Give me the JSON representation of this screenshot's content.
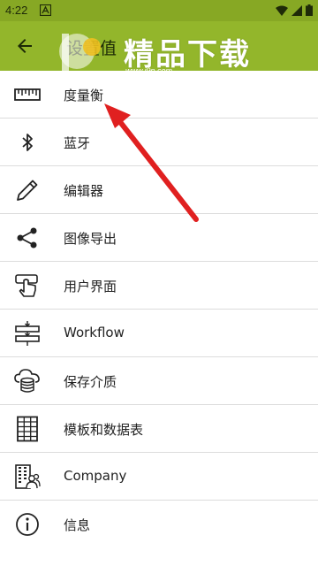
{
  "status_bar": {
    "time": "4:22"
  },
  "app_bar": {
    "title": "设置值"
  },
  "watermark": {
    "brand": "精品下载",
    "url": "www.j9p.com"
  },
  "menu": {
    "items": [
      {
        "label": "度量衡",
        "icon": "ruler-icon"
      },
      {
        "label": "蓝牙",
        "icon": "bluetooth-icon"
      },
      {
        "label": "编辑器",
        "icon": "pencil-icon"
      },
      {
        "label": "图像导出",
        "icon": "share-icon"
      },
      {
        "label": "用户界面",
        "icon": "touch-screen-icon"
      },
      {
        "label": "Workflow",
        "icon": "workflow-icon"
      },
      {
        "label": "保存介质",
        "icon": "cloud-storage-icon"
      },
      {
        "label": "模板和数据表",
        "icon": "table-icon"
      },
      {
        "label": "Company",
        "icon": "company-icon"
      },
      {
        "label": "信息",
        "icon": "info-icon"
      }
    ]
  },
  "colors": {
    "status_bar": "#87a824",
    "app_bar": "#93b62b",
    "annotation_arrow": "#e02020"
  }
}
